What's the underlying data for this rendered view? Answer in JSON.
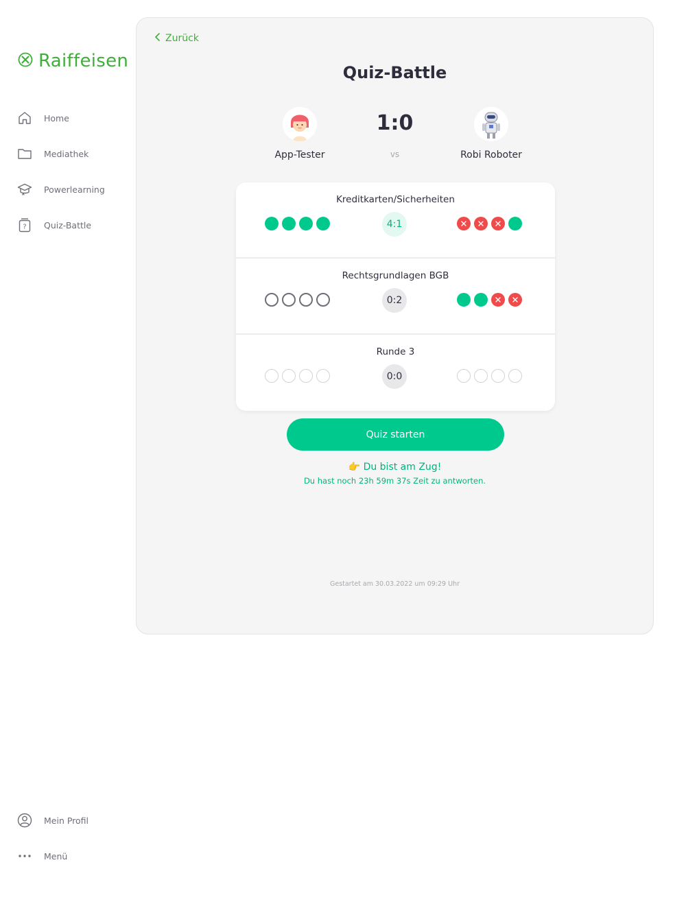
{
  "brand": {
    "name": "Raiffeisen",
    "color": "#3fae3a",
    "icon": "raiffeisen-cross-icon"
  },
  "sidebar": {
    "items": [
      {
        "label": "Home",
        "icon": "home-icon"
      },
      {
        "label": "Mediathek",
        "icon": "folder-icon"
      },
      {
        "label": "Powerlearning",
        "icon": "graduation-cap-icon"
      },
      {
        "label": "Quiz-Battle",
        "icon": "quiz-icon"
      }
    ],
    "bottom": [
      {
        "label": "Mein Profil",
        "icon": "user-circle-icon"
      },
      {
        "label": "Menü",
        "icon": "more-dots-icon"
      }
    ]
  },
  "header": {
    "back_label": "Zurück",
    "title": "Quiz-Battle"
  },
  "match": {
    "player_left": {
      "name": "App-Tester",
      "avatar": "girl-avatar"
    },
    "player_right": {
      "name": "Robi Roboter",
      "avatar": "robot-avatar"
    },
    "score": "1:0",
    "vs": "vs"
  },
  "rounds": [
    {
      "title": "Kreditkarten/Sicherheiten",
      "score": "4:1",
      "left": [
        "correct",
        "correct",
        "correct",
        "correct"
      ],
      "right": [
        "wrong",
        "wrong",
        "wrong",
        "correct"
      ]
    },
    {
      "title": "Rechtsgrundlagen BGB",
      "score": "0:2",
      "left": [
        "empty",
        "empty",
        "empty",
        "empty"
      ],
      "right": [
        "correct",
        "correct",
        "wrong",
        "wrong"
      ]
    },
    {
      "title": "Runde 3",
      "score": "0:0",
      "left": [
        "pending",
        "pending",
        "pending",
        "pending"
      ],
      "right": [
        "pending",
        "pending",
        "pending",
        "pending"
      ]
    }
  ],
  "actions": {
    "start_label": "Quiz starten",
    "turn_emoji": "👉",
    "turn_text": "Du bist am Zug!",
    "time_text": "Du hast noch 23h 59m 37s Zeit zu antworten."
  },
  "footer": {
    "started": "Gestartet am 30.03.2022 um 09:29 Uhr"
  },
  "colors": {
    "accent": "#00c98d",
    "wrong": "#f04a4a",
    "brand": "#3fae3a"
  }
}
